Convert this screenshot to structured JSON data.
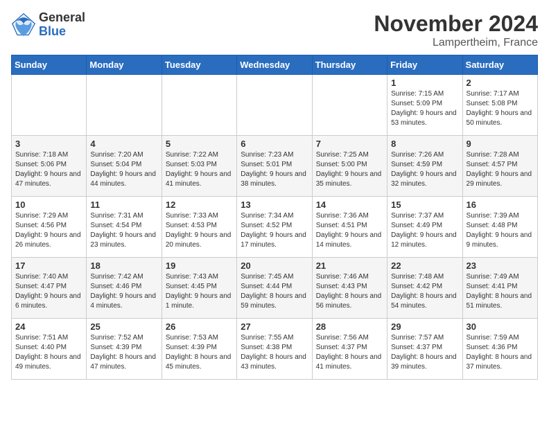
{
  "header": {
    "logo_general": "General",
    "logo_blue": "Blue",
    "month_title": "November 2024",
    "subtitle": "Lampertheim, France"
  },
  "weekdays": [
    "Sunday",
    "Monday",
    "Tuesday",
    "Wednesday",
    "Thursday",
    "Friday",
    "Saturday"
  ],
  "weeks": [
    [
      {
        "day": "",
        "info": ""
      },
      {
        "day": "",
        "info": ""
      },
      {
        "day": "",
        "info": ""
      },
      {
        "day": "",
        "info": ""
      },
      {
        "day": "",
        "info": ""
      },
      {
        "day": "1",
        "info": "Sunrise: 7:15 AM\nSunset: 5:09 PM\nDaylight: 9 hours and 53 minutes."
      },
      {
        "day": "2",
        "info": "Sunrise: 7:17 AM\nSunset: 5:08 PM\nDaylight: 9 hours and 50 minutes."
      }
    ],
    [
      {
        "day": "3",
        "info": "Sunrise: 7:18 AM\nSunset: 5:06 PM\nDaylight: 9 hours and 47 minutes."
      },
      {
        "day": "4",
        "info": "Sunrise: 7:20 AM\nSunset: 5:04 PM\nDaylight: 9 hours and 44 minutes."
      },
      {
        "day": "5",
        "info": "Sunrise: 7:22 AM\nSunset: 5:03 PM\nDaylight: 9 hours and 41 minutes."
      },
      {
        "day": "6",
        "info": "Sunrise: 7:23 AM\nSunset: 5:01 PM\nDaylight: 9 hours and 38 minutes."
      },
      {
        "day": "7",
        "info": "Sunrise: 7:25 AM\nSunset: 5:00 PM\nDaylight: 9 hours and 35 minutes."
      },
      {
        "day": "8",
        "info": "Sunrise: 7:26 AM\nSunset: 4:59 PM\nDaylight: 9 hours and 32 minutes."
      },
      {
        "day": "9",
        "info": "Sunrise: 7:28 AM\nSunset: 4:57 PM\nDaylight: 9 hours and 29 minutes."
      }
    ],
    [
      {
        "day": "10",
        "info": "Sunrise: 7:29 AM\nSunset: 4:56 PM\nDaylight: 9 hours and 26 minutes."
      },
      {
        "day": "11",
        "info": "Sunrise: 7:31 AM\nSunset: 4:54 PM\nDaylight: 9 hours and 23 minutes."
      },
      {
        "day": "12",
        "info": "Sunrise: 7:33 AM\nSunset: 4:53 PM\nDaylight: 9 hours and 20 minutes."
      },
      {
        "day": "13",
        "info": "Sunrise: 7:34 AM\nSunset: 4:52 PM\nDaylight: 9 hours and 17 minutes."
      },
      {
        "day": "14",
        "info": "Sunrise: 7:36 AM\nSunset: 4:51 PM\nDaylight: 9 hours and 14 minutes."
      },
      {
        "day": "15",
        "info": "Sunrise: 7:37 AM\nSunset: 4:49 PM\nDaylight: 9 hours and 12 minutes."
      },
      {
        "day": "16",
        "info": "Sunrise: 7:39 AM\nSunset: 4:48 PM\nDaylight: 9 hours and 9 minutes."
      }
    ],
    [
      {
        "day": "17",
        "info": "Sunrise: 7:40 AM\nSunset: 4:47 PM\nDaylight: 9 hours and 6 minutes."
      },
      {
        "day": "18",
        "info": "Sunrise: 7:42 AM\nSunset: 4:46 PM\nDaylight: 9 hours and 4 minutes."
      },
      {
        "day": "19",
        "info": "Sunrise: 7:43 AM\nSunset: 4:45 PM\nDaylight: 9 hours and 1 minute."
      },
      {
        "day": "20",
        "info": "Sunrise: 7:45 AM\nSunset: 4:44 PM\nDaylight: 8 hours and 59 minutes."
      },
      {
        "day": "21",
        "info": "Sunrise: 7:46 AM\nSunset: 4:43 PM\nDaylight: 8 hours and 56 minutes."
      },
      {
        "day": "22",
        "info": "Sunrise: 7:48 AM\nSunset: 4:42 PM\nDaylight: 8 hours and 54 minutes."
      },
      {
        "day": "23",
        "info": "Sunrise: 7:49 AM\nSunset: 4:41 PM\nDaylight: 8 hours and 51 minutes."
      }
    ],
    [
      {
        "day": "24",
        "info": "Sunrise: 7:51 AM\nSunset: 4:40 PM\nDaylight: 8 hours and 49 minutes."
      },
      {
        "day": "25",
        "info": "Sunrise: 7:52 AM\nSunset: 4:39 PM\nDaylight: 8 hours and 47 minutes."
      },
      {
        "day": "26",
        "info": "Sunrise: 7:53 AM\nSunset: 4:39 PM\nDaylight: 8 hours and 45 minutes."
      },
      {
        "day": "27",
        "info": "Sunrise: 7:55 AM\nSunset: 4:38 PM\nDaylight: 8 hours and 43 minutes."
      },
      {
        "day": "28",
        "info": "Sunrise: 7:56 AM\nSunset: 4:37 PM\nDaylight: 8 hours and 41 minutes."
      },
      {
        "day": "29",
        "info": "Sunrise: 7:57 AM\nSunset: 4:37 PM\nDaylight: 8 hours and 39 minutes."
      },
      {
        "day": "30",
        "info": "Sunrise: 7:59 AM\nSunset: 4:36 PM\nDaylight: 8 hours and 37 minutes."
      }
    ]
  ]
}
